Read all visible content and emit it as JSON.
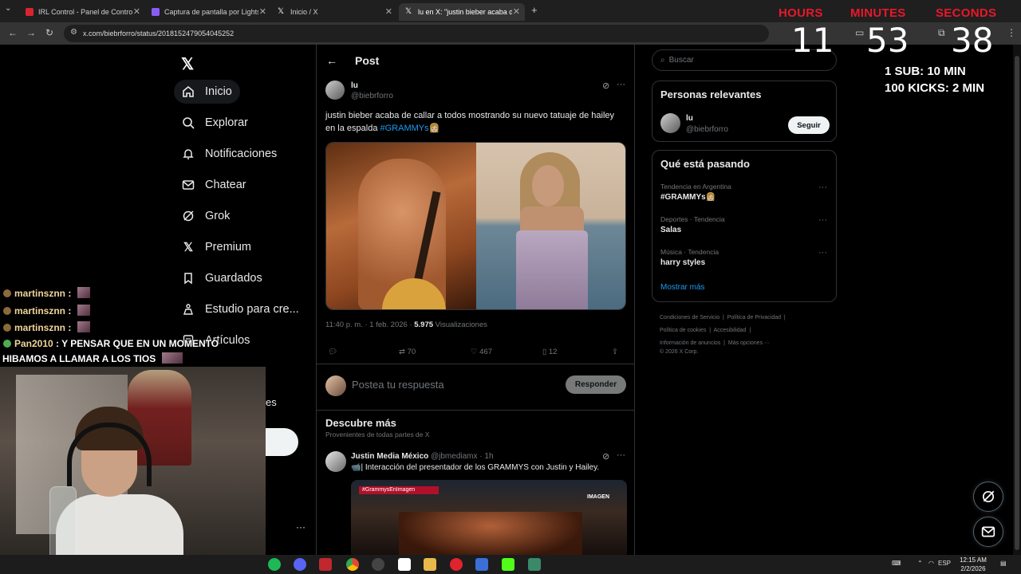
{
  "browser": {
    "tabs": [
      {
        "label": "IRL Control - Panel de Control"
      },
      {
        "label": "Captura de pantalla por Lightshot"
      },
      {
        "label": "Inicio / X"
      },
      {
        "label": "lu en X: \"justin bieber acaba de"
      }
    ],
    "url": "x.com/biebrforro/status/2018152479054045252"
  },
  "nav": {
    "items": [
      {
        "label": "Inicio"
      },
      {
        "label": "Explorar"
      },
      {
        "label": "Notificaciones"
      },
      {
        "label": "Chatear"
      },
      {
        "label": "Grok"
      },
      {
        "label": "Premium"
      },
      {
        "label": "Guardados"
      },
      {
        "label": "Estudio para cre..."
      },
      {
        "label": "Artículos"
      }
    ],
    "partial_label": "es"
  },
  "post": {
    "header_title": "Post",
    "author_name": "lu",
    "author_handle": "@biebrforro",
    "text": "justin bieber acaba de callar a todos mostrando su nuevo tatuaje de hailey en la espalda ",
    "hashtag": "#GRAMMYs",
    "emoji": "👩🏼",
    "time": "11:40 p. m. · 1 feb. 2026 · ",
    "views_count": "5.975",
    "views_label": " Visualizaciones",
    "retweets": "70",
    "likes": "467",
    "bookmarks": "12",
    "reply_placeholder": "Postea tu respuesta",
    "reply_button": "Responder"
  },
  "discover": {
    "title": "Descubre más",
    "subtitle": "Provenientes de todas partes de X",
    "tweet": {
      "author_name": "Justin Media México",
      "author_handle": "@jbmediamx · 1h",
      "text": "📹| Interacción del presentador de los GRAMMYS con Justin y Hailey.",
      "media_tag": "#GrammysEnImagen",
      "media_logo": "IMAGEN"
    }
  },
  "sidebar": {
    "search_placeholder": "Buscar",
    "relevant": {
      "title": "Personas relevantes",
      "name": "lu",
      "handle": "@biebrforro",
      "follow": "Seguir"
    },
    "trends": {
      "title": "Qué está pasando",
      "items": [
        {
          "category": "Tendencia en Argentina",
          "name": "#GRAMMYs👩🏼"
        },
        {
          "category": "Deportes · Tendencia",
          "name": "Salas"
        },
        {
          "category": "Música · Tendencia",
          "name": "harry styles"
        }
      ],
      "show_more": "Mostrar más"
    },
    "footer": {
      "line1a": "Condiciones de Servicio",
      "line1b": "Política de Privacidad",
      "line2a": "Política de cookies",
      "line2b": "Accesibilidad",
      "line3a": "Información de anuncios",
      "line3b": "Más opciones ···",
      "line4": "© 2026 X Corp."
    }
  },
  "overlay": {
    "timer_labels": {
      "hours": "HOURS",
      "minutes": "MINUTES",
      "seconds": "SECONDS"
    },
    "timer_values": {
      "hours": "11",
      "minutes": "53",
      "seconds": "38"
    },
    "info1": "1 SUB: 10 MIN",
    "info2": "100 KICKS: 2 MIN",
    "chat": [
      {
        "user": "martinsznn",
        "msg": ""
      },
      {
        "user": "martinsznn",
        "msg": ""
      },
      {
        "user": "martinsznn",
        "msg": ""
      },
      {
        "user": "Pan2010",
        "msg": "Y PENSAR QUE EN UN MOMENTO",
        "msg2": "HIBAMOS A LLAMAR A LOS TIOS"
      }
    ]
  },
  "taskbar": {
    "time": "12:15 AM",
    "date": "2/2/2026",
    "lang": "ESP"
  },
  "colors": {
    "accent": "#1d9bf0",
    "timer_red": "#e8182a"
  }
}
